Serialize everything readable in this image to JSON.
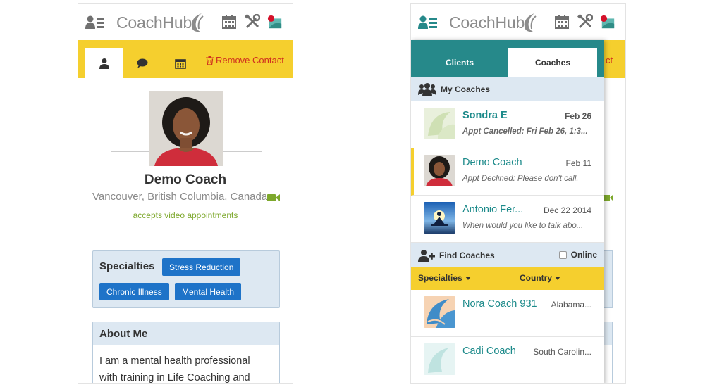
{
  "brand": {
    "name": "CoachHub"
  },
  "left_screen": {
    "tabs": [
      {
        "icon": "user-icon",
        "active": true
      },
      {
        "icon": "chat-icon",
        "active": false
      },
      {
        "icon": "calendar-icon",
        "active": false
      }
    ],
    "remove_contact_label": "Remove Contact",
    "profile": {
      "name": "Demo Coach",
      "location": "Vancouver, British Columbia, Canada",
      "video_note": "accepts video appointments"
    },
    "specialties": {
      "title": "Specialties",
      "tags": [
        "Stress Reduction",
        "Chronic Illness",
        "Mental Health"
      ]
    },
    "about": {
      "title": "About Me",
      "lines": [
        "I am a mental health professional",
        "with training in Life Coaching and"
      ]
    }
  },
  "right_screen": {
    "drawer_tabs": {
      "clients": "Clients",
      "coaches": "Coaches"
    },
    "bg_remove_fragment": "ct",
    "my_coaches_label": "My Coaches",
    "contacts": [
      {
        "name": "Sondra E",
        "date": "Feb 26",
        "message": "Appt Cancelled: Fri Feb 26, 1:3...",
        "unread": true
      },
      {
        "name": "Demo Coach",
        "date": "Feb 11",
        "message": "Appt Declined: Please don't call.",
        "unread": false
      },
      {
        "name": "Antonio Fer...",
        "date": "Dec 22 2014",
        "message": "When would you like to talk abo...",
        "unread": false
      }
    ],
    "find_coaches_label": "Find Coaches",
    "online_label": "Online",
    "filters": {
      "specialties": "Specialties",
      "country": "Country"
    },
    "results": [
      {
        "name": "Nora Coach 931",
        "location": "Alabama..."
      },
      {
        "name": "Cadi Coach",
        "location": "South Carolin..."
      }
    ]
  },
  "colors": {
    "accent_yellow": "#f5cf2e",
    "teal": "#26898a",
    "link_teal": "#1c8a8a",
    "tag_blue": "#1e73c8",
    "panel_blue": "#dde8f2",
    "danger_red": "#d0301f",
    "video_green": "#7da82c"
  }
}
